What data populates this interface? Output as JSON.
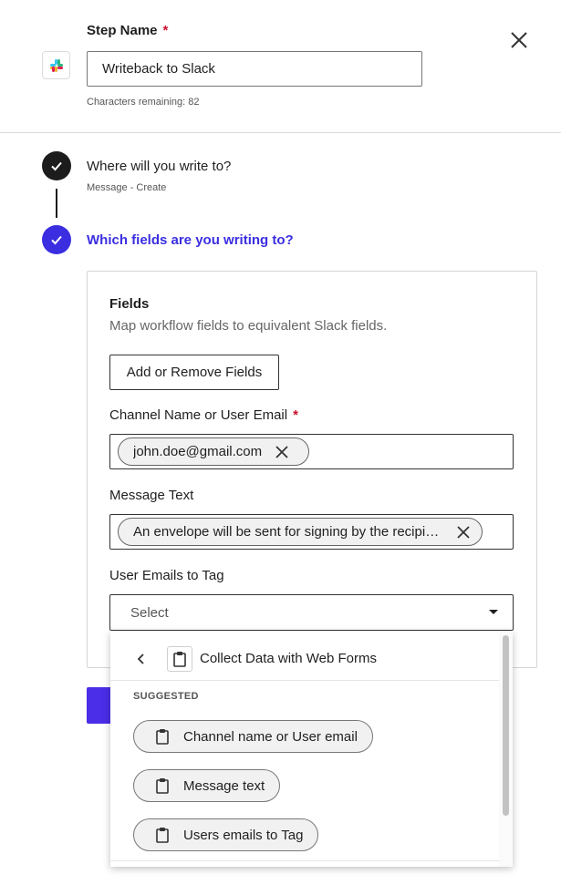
{
  "header": {
    "step_name_label": "Step Name",
    "required_mark": "*",
    "step_name_value": "Writeback to Slack",
    "characters_remaining": "Characters remaining: 82",
    "logo_icon": "slack-logo-icon",
    "close_icon": "close-icon"
  },
  "steps": [
    {
      "title": "Where will you write to?",
      "subtitle": "Message - Create",
      "status": "complete"
    },
    {
      "title": "Which fields are you writing to?",
      "status": "active"
    }
  ],
  "fields_panel": {
    "title": "Fields",
    "description": "Map workflow fields to equivalent Slack fields.",
    "add_remove_label": "Add or Remove Fields",
    "channel": {
      "label": "Channel Name or User Email",
      "required_mark": "*",
      "value": "john.doe@gmail.com"
    },
    "message": {
      "label": "Message Text",
      "value": "An envelope will be sent for signing by the recipient"
    },
    "user_emails": {
      "label": "User Emails to Tag",
      "placeholder": "Select"
    }
  },
  "dropdown": {
    "header_title": "Collect Data with Web Forms",
    "section_label": "SUGGESTED",
    "options": [
      {
        "label": "Channel name or User email",
        "icon": "clipboard-icon"
      },
      {
        "label": "Message text",
        "icon": "clipboard-icon"
      },
      {
        "label": "Users emails to Tag",
        "icon": "clipboard-icon"
      }
    ]
  },
  "colors": {
    "accent": "#3a2ee0",
    "primary_button": "#4a2ee8",
    "required": "#c8102e",
    "complete_step": "#1c1c1c"
  }
}
